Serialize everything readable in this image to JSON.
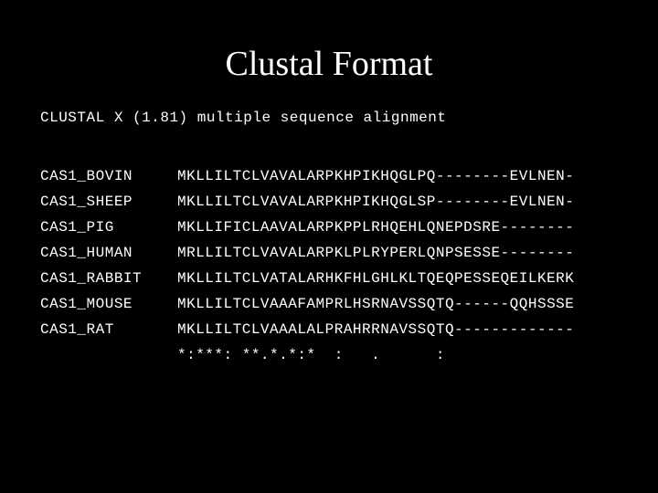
{
  "title": "Clustal Format",
  "header": "CLUSTAL X (1.81) multiple sequence alignment",
  "sequences": [
    {
      "name": "CAS1_BOVIN",
      "seq": "MKLLILTCLVAVALARPKHPIKHQGLPQ--------EVLNEN-"
    },
    {
      "name": "CAS1_SHEEP",
      "seq": "MKLLILTCLVAVALARPKHPIKHQGLSP--------EVLNEN-"
    },
    {
      "name": "CAS1_PIG",
      "seq": "MKLLIFICLAAVALARPKPPLRHQEHLQNEPDSRE--------"
    },
    {
      "name": "CAS1_HUMAN",
      "seq": "MRLLILTCLVAVALARPKLPLRYPERLQNPSESSE--------"
    },
    {
      "name": "CAS1_RABBIT",
      "seq": "MKLLILTCLVATALARHKFHLGHLKLTQEQPESSEQEILKERK"
    },
    {
      "name": "CAS1_MOUSE",
      "seq": "MKLLILTCLVAAAFAMPRLHSRNAVSSQTQ------QQHSSSE"
    },
    {
      "name": "CAS1_RAT",
      "seq": "MKLLILTCLVAAALALPRAHRRNAVSSQTQ-------------"
    }
  ],
  "conservation": "*:***: **.*.*:*  :   .      :"
}
